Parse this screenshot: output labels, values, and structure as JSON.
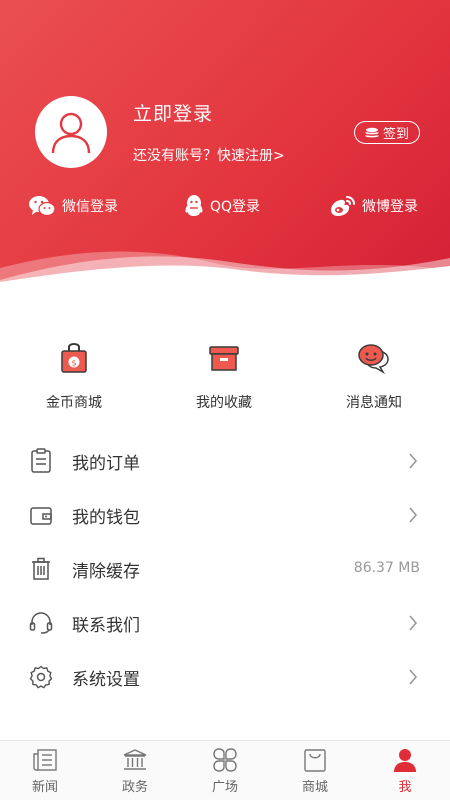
{
  "header": {
    "login_title": "立即登录",
    "register_text": "还没有账号？快速注册>",
    "signin_label": "签到",
    "social": [
      {
        "icon": "wechat-icon",
        "label": "微信登录"
      },
      {
        "icon": "qq-icon",
        "label": "QQ登录"
      },
      {
        "icon": "weibo-icon",
        "label": "微博登录"
      }
    ]
  },
  "quick_actions": [
    {
      "icon": "coin-bag-icon",
      "label": "金币商城"
    },
    {
      "icon": "archive-box-icon",
      "label": "我的收藏"
    },
    {
      "icon": "chat-bubble-icon",
      "label": "消息通知"
    }
  ],
  "menu": [
    {
      "icon": "clipboard-icon",
      "label": "我的订单",
      "value": ""
    },
    {
      "icon": "wallet-icon",
      "label": "我的钱包",
      "value": ""
    },
    {
      "icon": "trash-icon",
      "label": "清除缓存",
      "value": "86.37 MB"
    },
    {
      "icon": "headset-icon",
      "label": "联系我们",
      "value": ""
    },
    {
      "icon": "gear-icon",
      "label": "系统设置",
      "value": ""
    }
  ],
  "tabbar": [
    {
      "icon": "newspaper-icon",
      "label": "新闻",
      "active": false
    },
    {
      "icon": "government-icon",
      "label": "政务",
      "active": false
    },
    {
      "icon": "square-grid-icon",
      "label": "广场",
      "active": false
    },
    {
      "icon": "shopping-bag-icon",
      "label": "商城",
      "active": false
    },
    {
      "icon": "person-icon",
      "label": "我",
      "active": true
    }
  ],
  "colors": {
    "accent": "#e02e38",
    "header_start": "#ea4f50",
    "header_end": "#d31f36"
  }
}
